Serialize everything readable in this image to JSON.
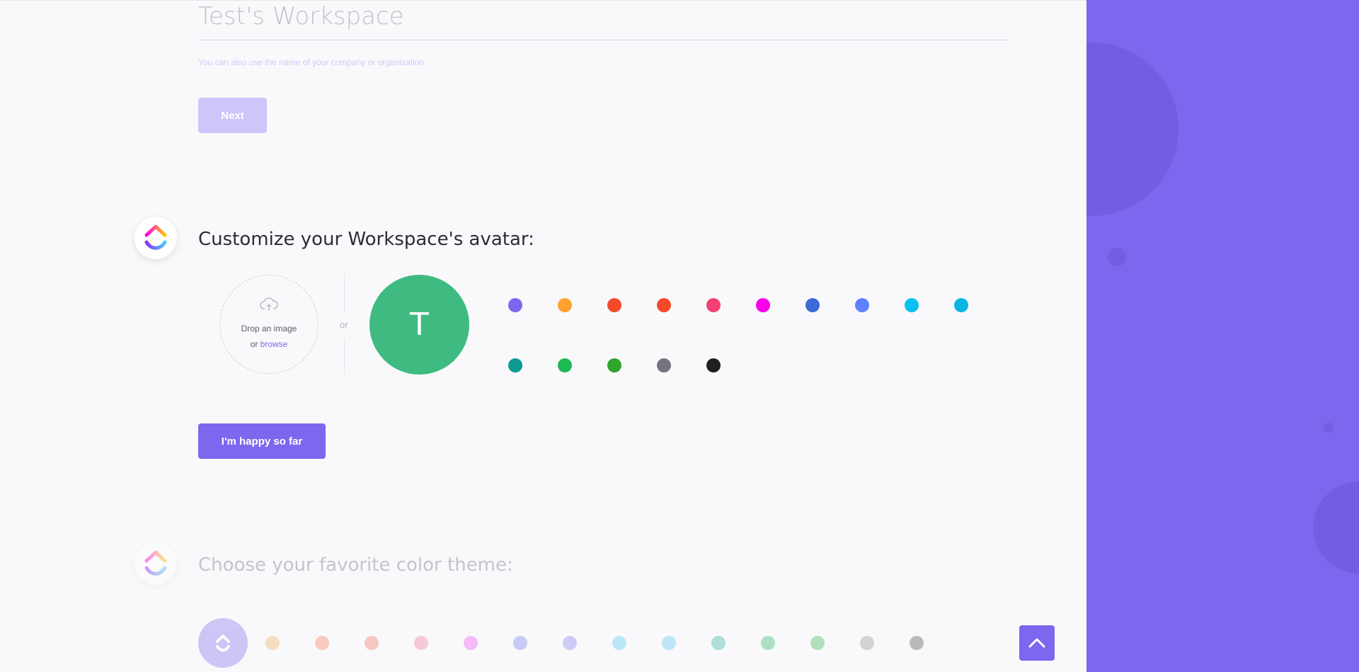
{
  "workspace": {
    "name_value": "Test's Workspace",
    "hint": "You can also use the name of your company or organization",
    "next_label": "Next"
  },
  "avatar_section": {
    "title": "Customize your Workspace's avatar:",
    "drop_text": "Drop an image",
    "or_prefix": "or",
    "browse_label": "browse",
    "or_separator": "or",
    "avatar_letter": "T",
    "avatar_color": "#3fbb82",
    "colors": [
      "#7b68ee",
      "#ffa12f",
      "#f44a2a",
      "#f44a2a",
      "#f43f74",
      "#f900ea",
      "#3d6ad6",
      "#5f81ff",
      "#0bc0f1",
      "#0ab5e3",
      "#0a9a91",
      "#1db954",
      "#2ea52c",
      "#757380",
      "#202020"
    ],
    "confirm_label": "I'm happy so far"
  },
  "theme_section": {
    "title": "Choose your favorite color theme:",
    "selected_color": "#7b68ee",
    "colors": [
      "#f0b36a",
      "#f7835e",
      "#f87e6f",
      "#f383a6",
      "#f25cf7",
      "#7b87ee",
      "#8b89f3",
      "#5fcdf2",
      "#64c9ee",
      "#3eb7a2",
      "#3dba6e",
      "#4dba62",
      "#9a9a9e",
      "#5c5c5e"
    ]
  },
  "colors": {
    "accent": "#7b68ee",
    "panel": "#7b68ee"
  },
  "icons": {
    "upload": "cloud-upload-icon",
    "scroll_top": "chevron-up-icon",
    "logo": "clickup-logo-icon"
  }
}
